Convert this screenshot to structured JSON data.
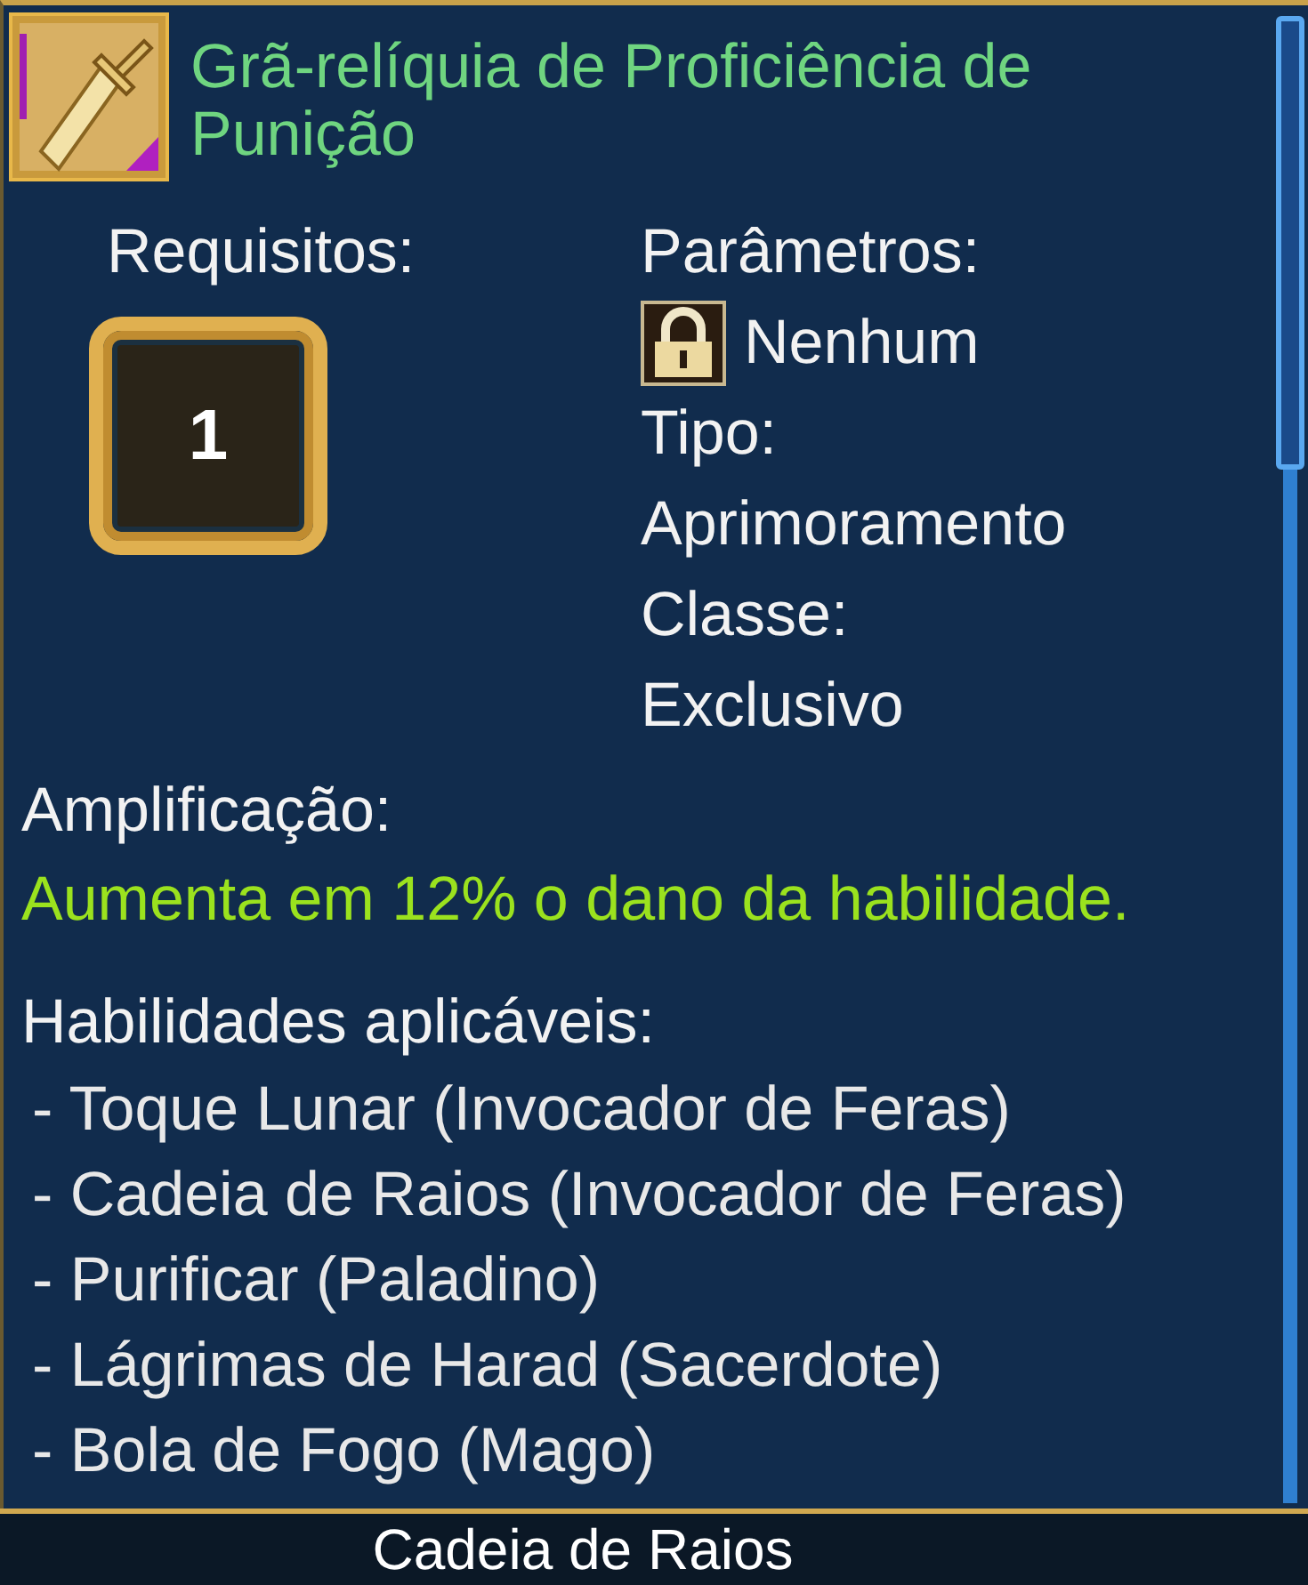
{
  "item": {
    "title": "Grã-relíquia de Proficiência de Punição"
  },
  "requirements": {
    "label": "Requisitos:",
    "level": "1"
  },
  "parameters": {
    "label": "Parâmetros:",
    "locked": true,
    "value": "Nenhum"
  },
  "type": {
    "label": "Tipo:",
    "value": "Aprimoramento"
  },
  "class": {
    "label": "Classe:",
    "value": "Exclusivo"
  },
  "amplification": {
    "label": "Amplificação:",
    "text": "Aumenta em 12% o dano da habilidade."
  },
  "skills": {
    "label": "Habilidades aplicáveis:",
    "items": [
      "- Toque Lunar (Invocador de Feras)",
      "- Cadeia de Raios (Invocador de Feras)",
      "- Purificar (Paladino)",
      "- Lágrimas de Harad (Sacerdote)",
      "- Bola de Fogo (Mago)"
    ]
  },
  "footer": {
    "text": "Cadeia de Raios"
  }
}
